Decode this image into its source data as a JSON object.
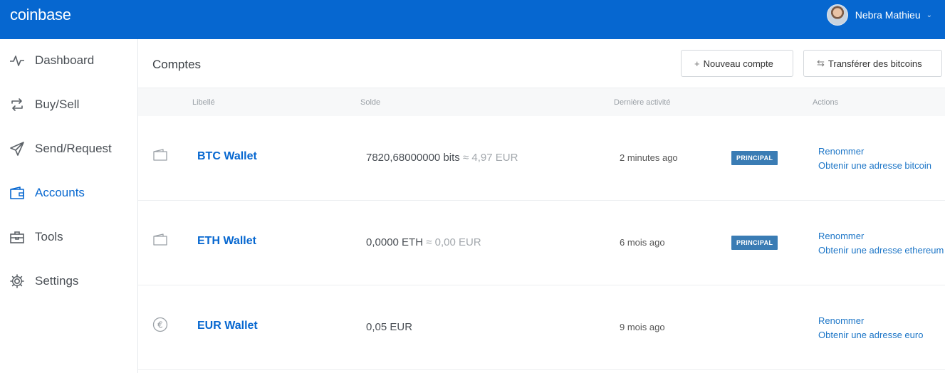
{
  "brand": {
    "name": "coinbase"
  },
  "user": {
    "name": "Nebra Mathieu"
  },
  "sidebar": {
    "items": [
      {
        "label": "Dashboard",
        "icon": "activity-icon",
        "active": false
      },
      {
        "label": "Buy/Sell",
        "icon": "swap-arrows-icon",
        "active": false
      },
      {
        "label": "Send/Request",
        "icon": "paper-plane-icon",
        "active": false
      },
      {
        "label": "Accounts",
        "icon": "wallet-icon",
        "active": true
      },
      {
        "label": "Tools",
        "icon": "toolbox-icon",
        "active": false
      },
      {
        "label": "Settings",
        "icon": "gear-icon",
        "active": false
      }
    ]
  },
  "header": {
    "title": "Comptes",
    "new_account_label": "Nouveau compte",
    "transfer_label": "Transférer des bitcoins"
  },
  "table": {
    "columns": [
      "Libellé",
      "Solde",
      "Dernière activité",
      "Actions"
    ],
    "rows": [
      {
        "icon": "wallet-icon",
        "name": "BTC Wallet",
        "balance": "7820,68000000 bits",
        "fiat": "≈ 4,97 EUR",
        "activity": "2 minutes ago",
        "badge": "PRINCIPAL",
        "rename": "Renommer",
        "address": "Obtenir une adresse bitcoin"
      },
      {
        "icon": "wallet-icon",
        "name": "ETH Wallet",
        "balance": "0,0000 ETH",
        "fiat": "≈ 0,00 EUR",
        "activity": "6 mois ago",
        "badge": "PRINCIPAL",
        "rename": "Renommer",
        "address": "Obtenir une adresse ethereum"
      },
      {
        "icon": "euro-coin-icon",
        "name": "EUR Wallet",
        "balance": "0,05 EUR",
        "fiat": "",
        "activity": "9 mois ago",
        "badge": "",
        "rename": "Renommer",
        "address": "Obtenir une adresse euro"
      }
    ]
  },
  "colors": {
    "brand_blue": "#0667d0",
    "badge_blue": "#3a7cb4",
    "link_blue": "#1d76c7"
  }
}
